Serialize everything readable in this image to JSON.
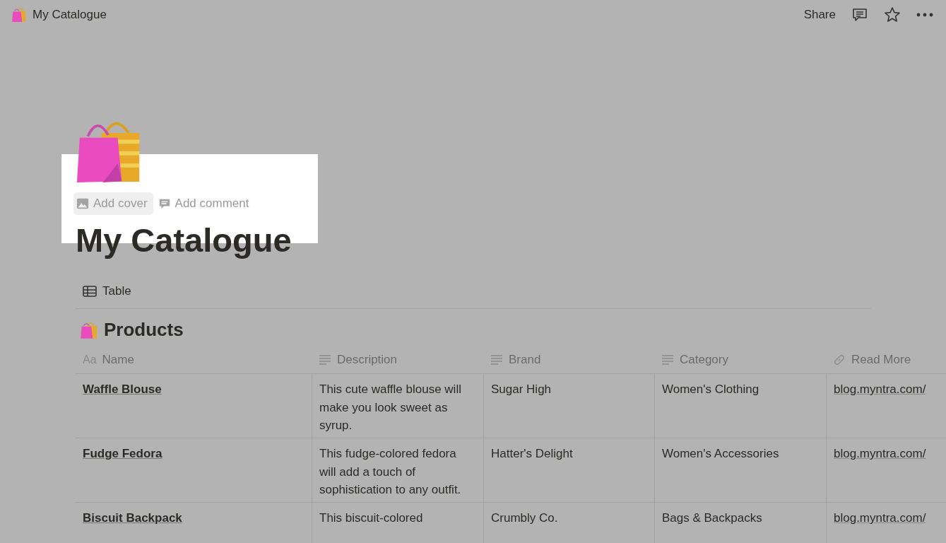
{
  "topbar": {
    "title": "My Catalogue",
    "actions": [
      "Share"
    ]
  },
  "page": {
    "add_actions": [
      {
        "label": "Add cover",
        "kind": "cover",
        "hovered": true
      },
      {
        "label": "Add comment",
        "kind": "comment",
        "hovered": false
      }
    ],
    "title": "My Catalogue"
  },
  "views": [
    {
      "label": "Table"
    }
  ],
  "table": {
    "title": "Products",
    "columns": [
      {
        "label": "Name",
        "kind": "title",
        "glyph": "Aa"
      },
      {
        "label": "Description",
        "kind": "text"
      },
      {
        "label": "Brand",
        "kind": "text"
      },
      {
        "label": "Category",
        "kind": "text"
      },
      {
        "label": "Read More",
        "kind": "url"
      }
    ],
    "rows": [
      [
        "Waffle Blouse",
        "This cute waffle blouse will make you look sweet as syrup.",
        "Sugar High",
        "Women's Clothing",
        "blog.myntra.com/"
      ],
      [
        "Fudge Fedora",
        "This fudge-colored fedora will add a touch of sophistication to any outfit.",
        "Hatter's Delight",
        "Women's Accessories",
        "blog.myntra.com/"
      ],
      [
        "Biscuit Backpack",
        "This biscuit-colored",
        "Crumbly Co.",
        "Bags & Backpacks",
        "blog.myntra.com/"
      ]
    ]
  }
}
